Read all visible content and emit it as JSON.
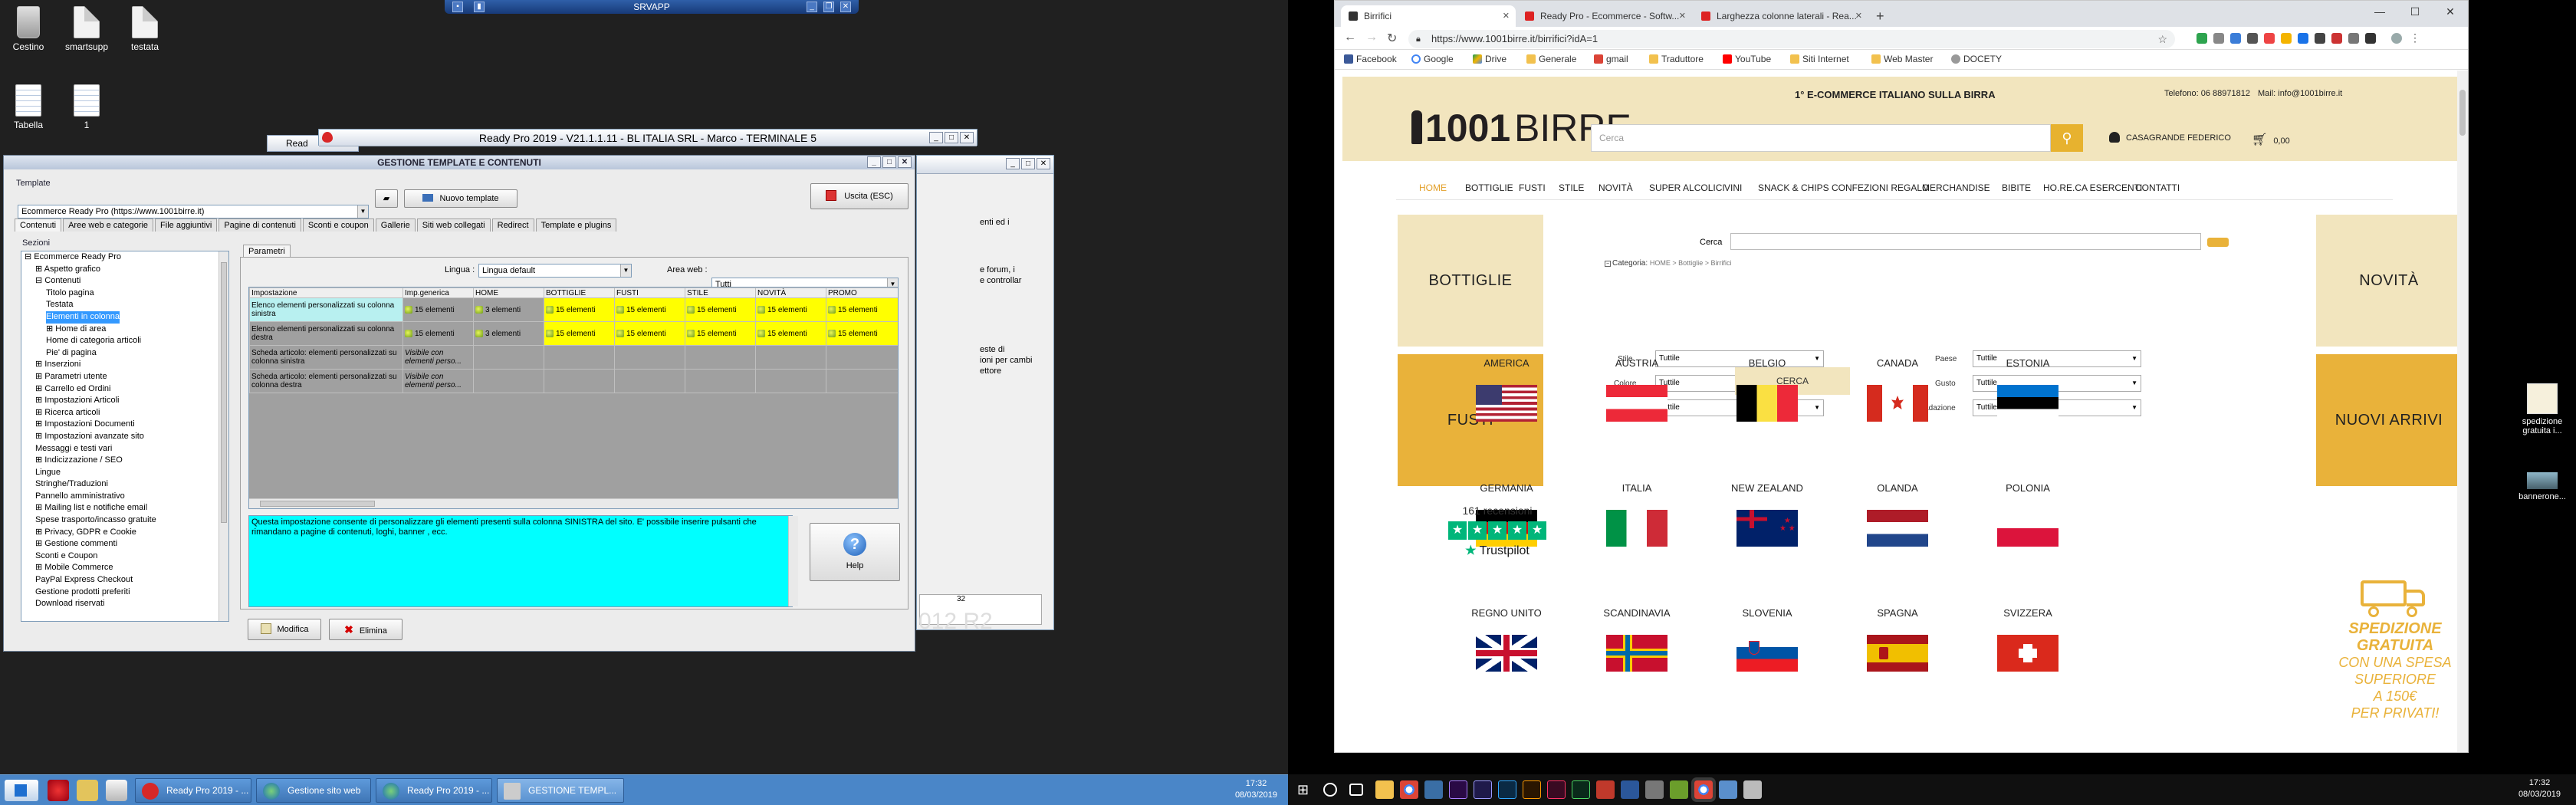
{
  "left_desktop": {
    "icons": [
      "Cestino",
      "smartsupp",
      "testata",
      "Tabella",
      "1"
    ],
    "srvapp_title": "SRVAPP",
    "r2_text": "012 R2"
  },
  "ready_main": {
    "title": "Ready Pro 2019 - V21.1.1.11 - BL ITALIA SRL - Marco - TERMINALE 5"
  },
  "ready_small_title": "Read",
  "gestione": {
    "title": "GESTIONE TEMPLATE E CONTENUTI",
    "template_group": "Template",
    "template_value": "Ecommerce Ready Pro (https://www.1001birre.it)",
    "new_template": "Nuovo template",
    "exit": "Uscita (ESC)",
    "tabs": [
      "Contenuti",
      "Aree web e categorie",
      "File aggiuntivi",
      "Pagine di contenuti",
      "Sconti e coupon",
      "Gallerie",
      "Siti web collegati",
      "Redirect",
      "Template e plugins"
    ],
    "sections_label": "Sezioni",
    "params_tab": "Parametri",
    "lingua_label": "Lingua :",
    "lingua_value": "Lingua default",
    "area_label": "Area web :",
    "area_value": "Tutti",
    "tree": [
      {
        "t": "⊟ Ecommerce Ready Pro",
        "ind": 0
      },
      {
        "t": "⊞ Aspetto grafico",
        "ind": 1
      },
      {
        "t": "⊟ Contenuti",
        "ind": 1
      },
      {
        "t": "Titolo pagina",
        "ind": 2
      },
      {
        "t": "Testata",
        "ind": 2
      },
      {
        "t": "Elementi in colonna",
        "ind": 2,
        "sel": true
      },
      {
        "t": "⊞ Home di area",
        "ind": 2
      },
      {
        "t": "Home di categoria articoli",
        "ind": 2
      },
      {
        "t": "Pie' di pagina",
        "ind": 2
      },
      {
        "t": "⊞ Inserzioni",
        "ind": 1
      },
      {
        "t": "⊞ Parametri utente",
        "ind": 1
      },
      {
        "t": "⊞ Carrello ed Ordini",
        "ind": 1
      },
      {
        "t": "⊞ Impostazioni Articoli",
        "ind": 1
      },
      {
        "t": "⊞ Ricerca articoli",
        "ind": 1
      },
      {
        "t": "⊞ Impostazioni Documenti",
        "ind": 1
      },
      {
        "t": "⊞ Impostazioni avanzate sito",
        "ind": 1
      },
      {
        "t": "Messaggi e testi vari",
        "ind": 1
      },
      {
        "t": "⊞ Indicizzazione / SEO",
        "ind": 1
      },
      {
        "t": "Lingue",
        "ind": 1
      },
      {
        "t": "Stringhe/Traduzioni",
        "ind": 1
      },
      {
        "t": "Pannello amministrativo",
        "ind": 1
      },
      {
        "t": "⊞ Mailing list e notifiche email",
        "ind": 1
      },
      {
        "t": "Spese trasporto/incasso gratuite",
        "ind": 1
      },
      {
        "t": "⊞ Privacy, GDPR e Cookie",
        "ind": 1
      },
      {
        "t": "⊞ Gestione commenti",
        "ind": 1
      },
      {
        "t": "Sconti e Coupon",
        "ind": 1
      },
      {
        "t": "⊞ Mobile Commerce",
        "ind": 1
      },
      {
        "t": "PayPal Express Checkout",
        "ind": 1
      },
      {
        "t": "Gestione prodotti preferiti",
        "ind": 1
      },
      {
        "t": "Download riservati",
        "ind": 1
      }
    ],
    "grid_headers": [
      "Impostazione",
      "Imp.generica",
      "HOME",
      "BOTTIGLIE",
      "FUSTI",
      "STILE",
      "NOVITÀ",
      "PROMO"
    ],
    "grid_rows": [
      {
        "name": "Elenco elementi personalizzati su colonna sinistra",
        "cells": [
          "15 elementi",
          "3 elementi",
          "15 elementi",
          "15 elementi",
          "15 elementi",
          "15 elementi",
          "15 elementi",
          "15 elementi"
        ]
      },
      {
        "name": "Elenco elementi personalizzati su colonna destra",
        "cells": [
          "15 elementi",
          "3 elementi",
          "15 elementi",
          "15 elementi",
          "15 elementi",
          "15 elementi",
          "15 elementi",
          "15 elementi"
        ]
      },
      {
        "name": "Scheda articolo: elementi personalizzati su colonna sinistra",
        "cells": [
          "Visibile con elementi perso...",
          "",
          "",
          "",
          "",
          "",
          "",
          ""
        ]
      },
      {
        "name": "Scheda articolo: elementi personalizzati su colonna destra",
        "cells": [
          "Visibile con elementi perso...",
          "",
          "",
          "",
          "",
          "",
          "",
          ""
        ]
      }
    ],
    "help_text": "Questa impostazione consente di personalizzare gli elementi presenti sulla colonna SINISTRA del sito. E' possibile inserire pulsanti che rimandano a pagine di contenuti, loghi, banner , ecc.",
    "help_button": "Help",
    "modify": "Modifica",
    "delete": "Elimina"
  },
  "bg_right": {
    "lines": [
      "enti ed i",
      "e forum, i",
      "e controllar",
      "este di",
      "ioni per cambi",
      "ettore"
    ],
    "num": "32"
  },
  "taskbar_left": {
    "items": [
      "Ready Pro 2019 - ...",
      "Gestione sito web",
      "Ready Pro 2019 - ...",
      "GESTIONE TEMPL..."
    ],
    "time": "17:32",
    "date": "08/03/2019"
  },
  "chrome": {
    "tabs": [
      "Birrifici",
      "Ready Pro - Ecommerce - Softw...",
      "Larghezza colonne laterali - Rea..."
    ],
    "url": "https://www.1001birre.it/birrifici?idA=1",
    "bookmarks": [
      "Facebook",
      "Google",
      "Drive",
      "Generale",
      "gmail",
      "Traduttore",
      "YouTube",
      "Siti Internet",
      "Web Master",
      "DOCETY"
    ]
  },
  "site": {
    "logo_num": "1001",
    "logo_word": "BIRRE",
    "tagline": "1° E-COMMERCE ITALIANO SULLA BIRRA",
    "phone": "Telefono: 06 88971812",
    "mail": "Mail: info@1001birre.it",
    "search_placeholder": "Cerca",
    "user": "CASAGRANDE FEDERICO",
    "cart": "0,00",
    "nav": [
      "HOME",
      "BOTTIGLIE",
      "FUSTI",
      "STILE",
      "NOVITÀ",
      "SUPER ALCOLICI",
      "VINI",
      "SNACK & CHIPS",
      "CONFEZIONI REGALO",
      "MERCHANDISE",
      "BIBITE",
      "HO.RE.CA ESERCENTI",
      "CONTATTI"
    ],
    "left_boxes": [
      "BOTTIGLIE",
      "FUSTI"
    ],
    "right_boxes": [
      "NOVITÀ",
      "NUOVI ARRIVI"
    ],
    "cerca_label": "Cerca",
    "breadcrumb_title": "Categoria:",
    "breadcrumb": "HOME > Bottiglie > Birrifici",
    "filters": [
      {
        "label": "Stile",
        "value": "Tuttile"
      },
      {
        "label": "Paese",
        "value": "Tuttile"
      },
      {
        "label": "Colore",
        "value": "Tuttile"
      },
      {
        "label": "Gusto",
        "value": "Tuttile"
      },
      {
        "label": "Formato",
        "value": "Tuttile"
      },
      {
        "label": "Gradazione",
        "value": "Tuttile"
      }
    ],
    "cerca_button": "CERCA",
    "countries": [
      "AMERICA",
      "AUSTRIA",
      "BELGIO",
      "CANADA",
      "ESTONIA",
      "GERMANIA",
      "ITALIA",
      "NEW ZEALAND",
      "OLANDA",
      "POLONIA",
      "REGNO UNITO",
      "SCANDINAVIA",
      "SLOVENIA",
      "SPAGNA",
      "SVIZZERA"
    ],
    "reviews": "161 recensioni",
    "trustpilot": "Trustpilot",
    "promo": [
      "SPEDIZIONE",
      "GRATUITA",
      "CON UNA SPESA",
      "SUPERIORE",
      "A 150€",
      "PER PRIVATI!"
    ]
  },
  "right_desktop_icons": [
    "spedizione gratuita i...",
    "bannerone..."
  ],
  "taskbar_right": {
    "time": "17:32",
    "date": "08/03/2019"
  }
}
